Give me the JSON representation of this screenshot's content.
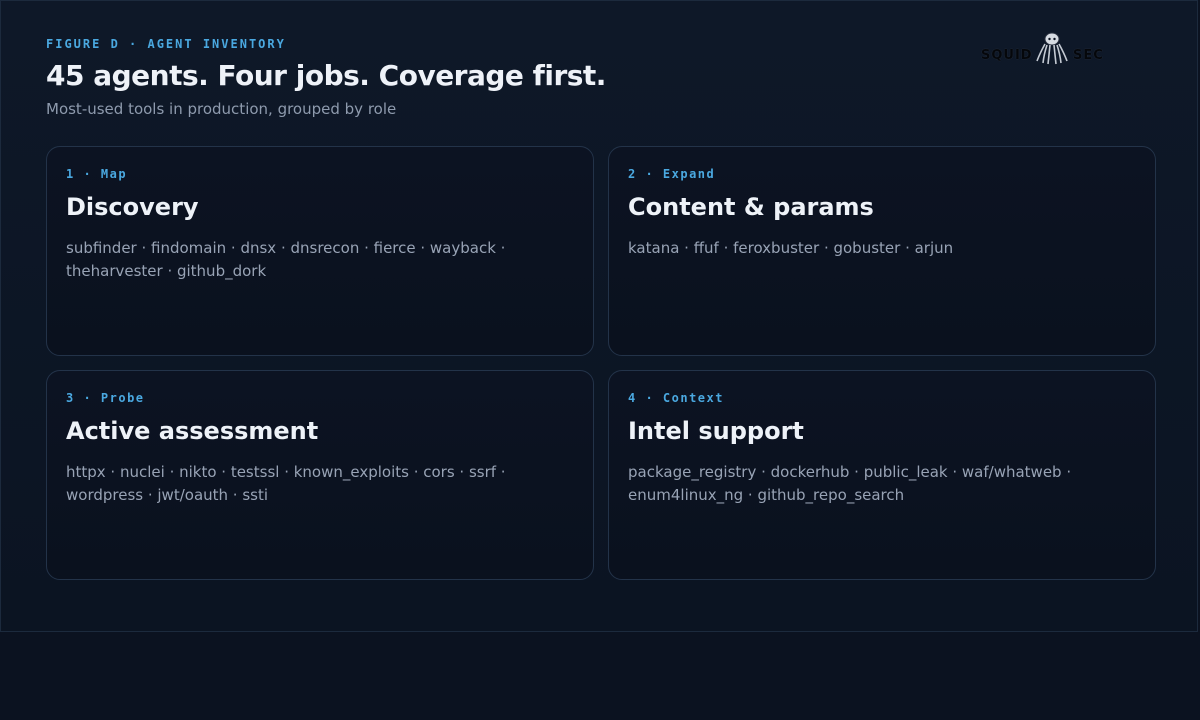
{
  "header": {
    "eyebrow": "FIGURE D · AGENT INVENTORY",
    "title": "45 agents. Four jobs. Coverage first.",
    "subtitle": "Most-used tools in production, grouped by role"
  },
  "logo": {
    "left_word": "SQUID",
    "right_word": "SEC",
    "mark_icon": "squid-icon"
  },
  "cards": [
    {
      "step": "1 · Map",
      "title": "Discovery",
      "tools": "subfinder · findomain · dnsx · dnsrecon · fierce · wayback · theharvester · github_dork"
    },
    {
      "step": "2 · Expand",
      "title": "Content & params",
      "tools": "katana · ffuf · feroxbuster · gobuster · arjun"
    },
    {
      "step": "3 · Probe",
      "title": "Active assessment",
      "tools": "httpx · nuclei · nikto · testssl · known_exploits · cors · ssrf · wordpress · jwt/oauth · ssti"
    },
    {
      "step": "4 · Context",
      "title": "Intel support",
      "tools": "package_registry · dockerhub · public_leak · waf/whatweb · enum4linux_ng · github_repo_search"
    }
  ],
  "colors": {
    "accent": "#4aa8e0",
    "background": "#0b1220",
    "card_border": "#233349",
    "heading": "#eef2f8",
    "muted": "#98a3b5"
  }
}
